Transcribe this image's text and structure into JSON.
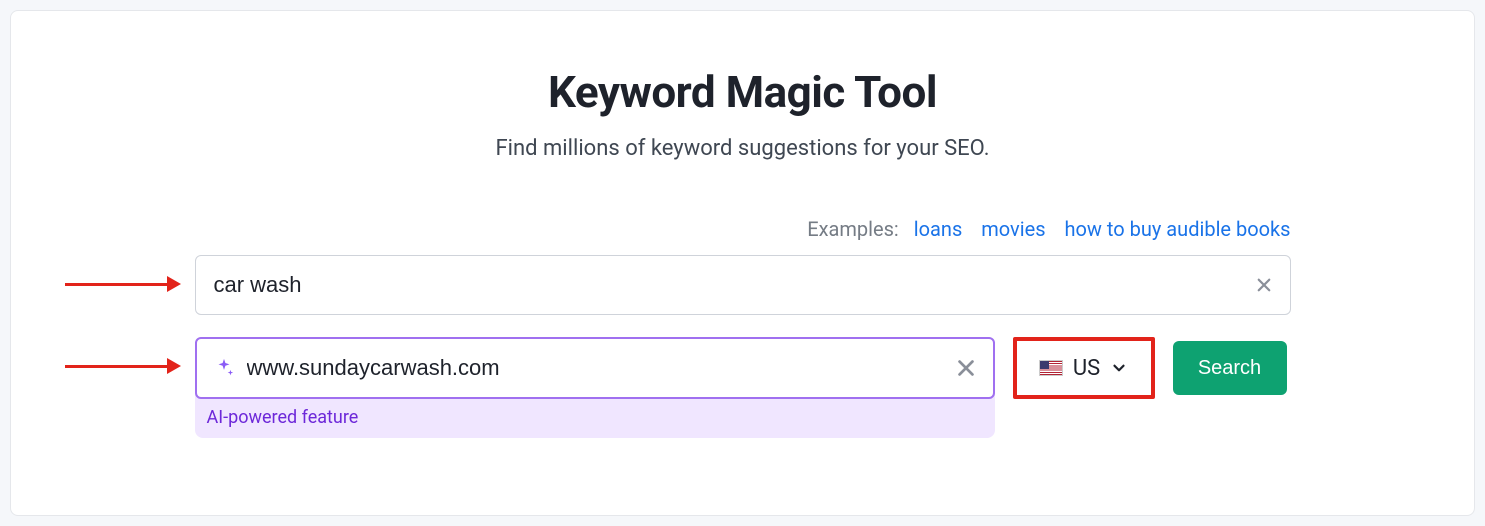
{
  "header": {
    "title": "Keyword Magic Tool",
    "subtitle": "Find millions of keyword suggestions for your SEO."
  },
  "examples": {
    "label": "Examples:",
    "links": [
      "loans",
      "movies",
      "how to buy audible books"
    ]
  },
  "keyword": {
    "value": "car wash"
  },
  "domain": {
    "value": "www.sundaycarwash.com",
    "caption": "AI-powered feature"
  },
  "country": {
    "code": "US"
  },
  "search": {
    "label": "Search"
  }
}
